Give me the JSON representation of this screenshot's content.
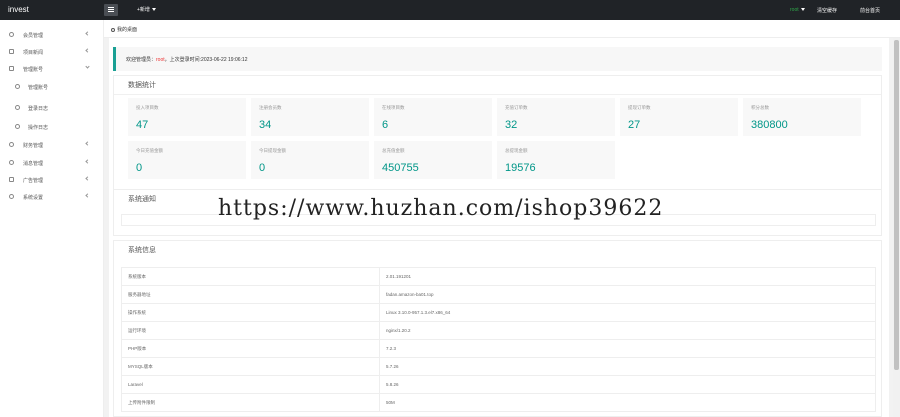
{
  "topbar": {
    "logo": "invest",
    "new_button": "+新增",
    "user": "root",
    "clear_cache": "清空缓存",
    "front_home": "前台首页"
  },
  "sidebar": {
    "items": [
      {
        "label": "会员管理",
        "icon": "user-icon"
      },
      {
        "label": "项目新闻",
        "icon": "news-icon"
      },
      {
        "label": "管理账号",
        "icon": "admin-icon"
      },
      {
        "label": "管理账号",
        "icon": "key-icon"
      },
      {
        "label": "登录日志",
        "icon": "log-icon"
      },
      {
        "label": "操作日志",
        "icon": "log-icon"
      },
      {
        "label": "财务管理",
        "icon": "finance-icon"
      },
      {
        "label": "消息管理",
        "icon": "message-icon"
      },
      {
        "label": "广告管理",
        "icon": "ad-icon"
      },
      {
        "label": "系统设置",
        "icon": "settings-icon"
      }
    ]
  },
  "tab": {
    "label": "我的桌面"
  },
  "welcome": {
    "prefix": "欢迎管理员：",
    "user": "root",
    "login_time": "上次登录时间:2023-06-22 19:06:12"
  },
  "stats": {
    "title": "数据统计",
    "cards": [
      {
        "label": "投入项目数",
        "value": "47"
      },
      {
        "label": "注册会员数",
        "value": "34"
      },
      {
        "label": "在线项目数",
        "value": "6"
      },
      {
        "label": "充值订单数",
        "value": "32"
      },
      {
        "label": "提现订单数",
        "value": "27"
      },
      {
        "label": "积分总数",
        "value": "380800"
      },
      {
        "label": "今日充值金额",
        "value": "0"
      },
      {
        "label": "今日提现金额",
        "value": "0"
      },
      {
        "label": "总充值金额",
        "value": "450755"
      },
      {
        "label": "总提现金额",
        "value": "19576"
      }
    ]
  },
  "notice": {
    "title": "系统通知"
  },
  "sysinfo": {
    "title": "系统信息",
    "rows": [
      {
        "key": "系统版本",
        "value": "2.01.191201"
      },
      {
        "key": "服务器地址",
        "value": "fadan.amazon-ba01.top"
      },
      {
        "key": "操作系统",
        "value": "Linux 3.10.0-957.1.3.el7.x86_64"
      },
      {
        "key": "运行环境",
        "value": "nginx/1.20.2"
      },
      {
        "key": "PHP版本",
        "value": "7.2.3"
      },
      {
        "key": "MYSQL版本",
        "value": "5.7.26"
      },
      {
        "key": "Laravel",
        "value": "5.8.26"
      },
      {
        "key": "上传附件限制",
        "value": "50M"
      }
    ]
  },
  "watermark": "https://www.huzhan.com/ishop39622"
}
